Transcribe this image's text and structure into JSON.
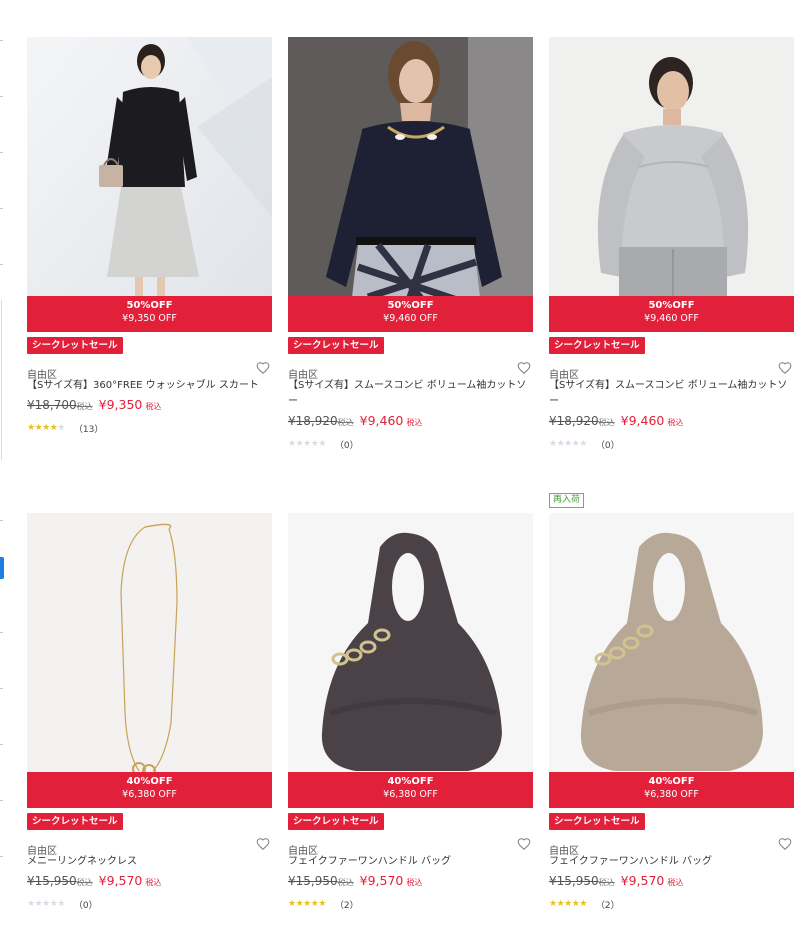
{
  "products": [
    {
      "discount_percent": "50%OFF",
      "discount_amount": "¥9,350 OFF",
      "sale_tag": "シークレットセール",
      "brand": "自由区",
      "title": "【Sサイズ有】360°FREE ウォッシャブル スカート",
      "original_price": "¥18,700",
      "original_tax": "税込",
      "sale_price": "¥9,350",
      "sale_tax": "税込",
      "rating": 4,
      "review_count": "（13）",
      "restock": ""
    },
    {
      "discount_percent": "50%OFF",
      "discount_amount": "¥9,460 OFF",
      "sale_tag": "シークレットセール",
      "brand": "自由区",
      "title": "【Sサイズ有】スムースコンビ ボリューム袖カットソー",
      "original_price": "¥18,920",
      "original_tax": "税込",
      "sale_price": "¥9,460",
      "sale_tax": "税込",
      "rating": 0,
      "review_count": "（0）",
      "restock": ""
    },
    {
      "discount_percent": "50%OFF",
      "discount_amount": "¥9,460 OFF",
      "sale_tag": "シークレットセール",
      "brand": "自由区",
      "title": "【Sサイズ有】スムースコンビ ボリューム袖カットソー",
      "original_price": "¥18,920",
      "original_tax": "税込",
      "sale_price": "¥9,460",
      "sale_tax": "税込",
      "rating": 0,
      "review_count": "（0）",
      "restock": ""
    },
    {
      "discount_percent": "40%OFF",
      "discount_amount": "¥6,380 OFF",
      "sale_tag": "シークレットセール",
      "brand": "自由区",
      "title": "メニーリングネックレス",
      "original_price": "¥15,950",
      "original_tax": "税込",
      "sale_price": "¥9,570",
      "sale_tax": "税込",
      "rating": 0,
      "review_count": "（0）",
      "restock": ""
    },
    {
      "discount_percent": "40%OFF",
      "discount_amount": "¥6,380 OFF",
      "sale_tag": "シークレットセール",
      "brand": "自由区",
      "title": "フェイクファーワンハンドル バッグ",
      "original_price": "¥15,950",
      "original_tax": "税込",
      "sale_price": "¥9,570",
      "sale_tax": "税込",
      "rating": 5,
      "review_count": "（2）",
      "restock": ""
    },
    {
      "discount_percent": "40%OFF",
      "discount_amount": "¥6,380 OFF",
      "sale_tag": "シークレットセール",
      "brand": "自由区",
      "title": "フェイクファーワンハンドル バッグ",
      "original_price": "¥15,950",
      "original_tax": "税込",
      "sale_price": "¥9,570",
      "sale_tax": "税込",
      "rating": 5,
      "review_count": "（2）",
      "restock": "再入荷"
    }
  ],
  "colors": {
    "accent_red": "#e2203a",
    "star_on": "#e6c21a",
    "star_off": "#d6dde5",
    "restock_green": "#4a9a3b"
  },
  "icons": {
    "favorite": "heart-outline-icon",
    "rating": "star-icon"
  }
}
